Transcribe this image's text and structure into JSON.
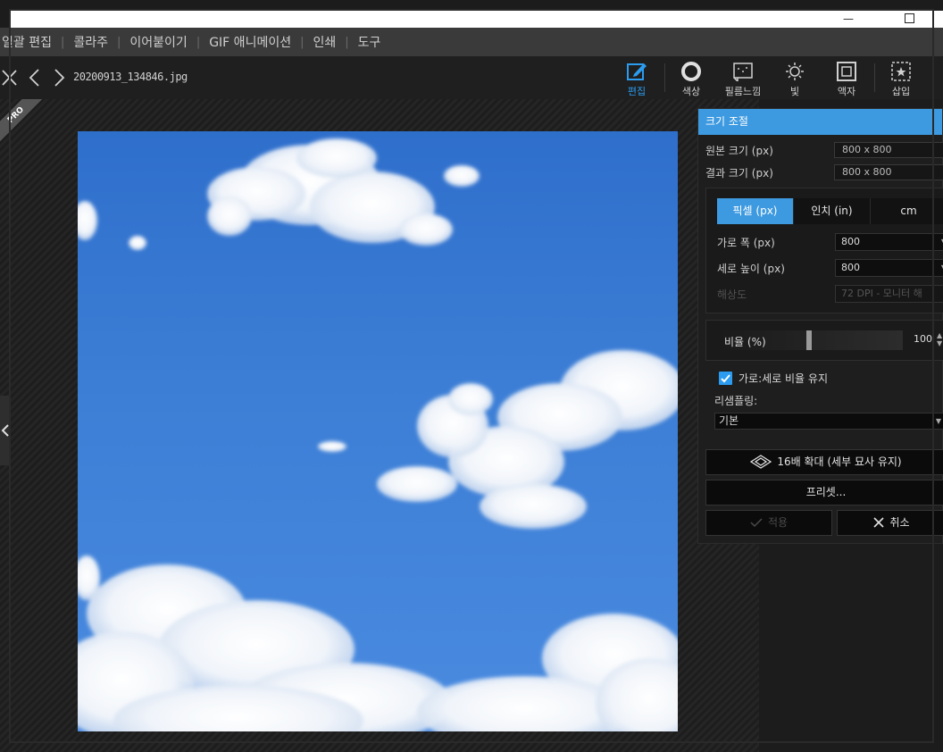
{
  "menu": {
    "items": [
      "일괄 편집",
      "콜라주",
      "이어붙이기",
      "GIF 애니메이션",
      "인쇄",
      "도구"
    ],
    "separator": "|"
  },
  "toolbar": {
    "filename": "20200913_134846.jpg",
    "tools": [
      {
        "label": "편집",
        "icon": "edit-icon",
        "active": true
      },
      {
        "label": "색상",
        "icon": "color-circle-icon",
        "active": false
      },
      {
        "label": "필름느낌",
        "icon": "film-icon",
        "active": false
      },
      {
        "label": "빛",
        "icon": "sun-icon",
        "active": false
      },
      {
        "label": "액자",
        "icon": "frame-icon",
        "active": false
      },
      {
        "label": "삽입",
        "icon": "insert-star-icon",
        "active": false
      }
    ]
  },
  "badge": {
    "text": "PRO"
  },
  "panel": {
    "title": "크기 조절",
    "original_size_label": "원본 크기 (px)",
    "original_size_value": "800 x 800",
    "result_size_label": "결과 크기 (px)",
    "result_size_value": "800 x 800",
    "units": [
      "픽셀 (px)",
      "인치 (in)",
      "cm"
    ],
    "selected_unit": "픽셀 (px)",
    "width_label": "가로 폭 (px)",
    "width_value": "800",
    "height_label": "세로 높이 (px)",
    "height_value": "800",
    "resolution_label": "해상도",
    "resolution_value": "72 DPI - 모니터 해",
    "ratio_label": "비율 (%)",
    "ratio_value": "100",
    "keep_ratio_label": "가로:세로 비율 유지",
    "keep_ratio_checked": true,
    "resampling_label": "리샘플링:",
    "resampling_value": "기본",
    "upscale_button": "16배 확대 (세부 묘사 유지)",
    "preset_button": "프리셋...",
    "apply_button": "적용",
    "cancel_button": "취소"
  },
  "colors": {
    "accent": "#3d9ae0",
    "active_tool": "#2b9cf0",
    "sky": "#3d7fd6"
  }
}
